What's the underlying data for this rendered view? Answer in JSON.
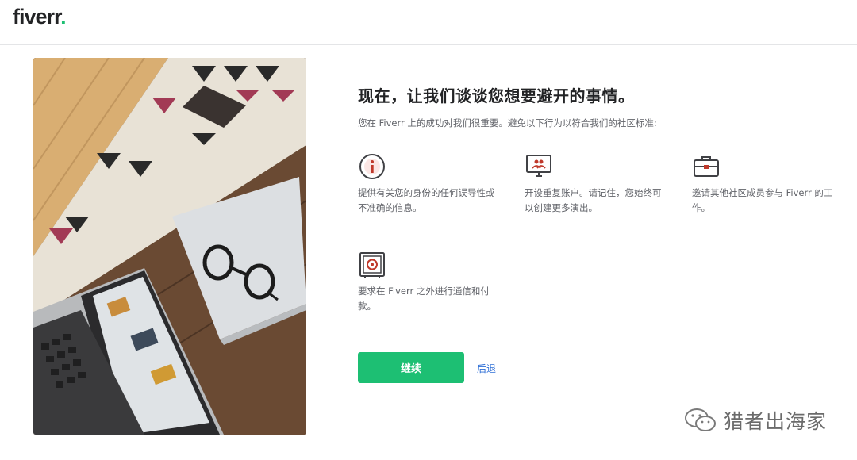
{
  "brand": {
    "name": "fiverr",
    "dot": "."
  },
  "heading": {
    "title": "现在，让我们谈谈您想要避开的事情。",
    "subtitle": "您在 Fiverr 上的成功对我们很重要。避免以下行为以符合我们的社区标准:"
  },
  "items": [
    {
      "icon": "info-icon",
      "text": "提供有关您的身份的任何误导性或不准确的信息。"
    },
    {
      "icon": "duplicate-account-icon",
      "text": "开设重复账户。请记住，您始终可以创建更多演出。"
    },
    {
      "icon": "briefcase-icon",
      "text": "邀请其他社区成员参与 Fiverr 的工作。"
    },
    {
      "icon": "safe-icon",
      "text": "要求在 Fiverr 之外进行通信和付款。"
    }
  ],
  "actions": {
    "continue_label": "继续",
    "back_label": "后退"
  },
  "watermark": {
    "text": "猎者出海家",
    "icon": "wechat-icon"
  },
  "colors": {
    "accent": "#1dbf73",
    "link": "#2f6fd6",
    "icon_red": "#c0392b"
  }
}
